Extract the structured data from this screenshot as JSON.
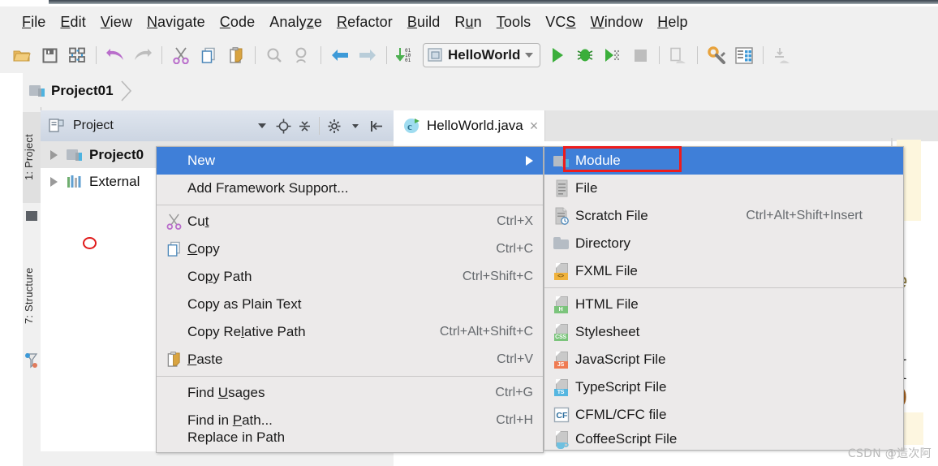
{
  "window": {
    "breadcrumb": "Project01"
  },
  "menubar": {
    "items": [
      {
        "label": "File",
        "mnemonic": "F"
      },
      {
        "label": "Edit",
        "mnemonic": "E"
      },
      {
        "label": "View",
        "mnemonic": "V"
      },
      {
        "label": "Navigate",
        "mnemonic": "N"
      },
      {
        "label": "Code",
        "mnemonic": "C"
      },
      {
        "label": "Analyze",
        "mnemonic": "z"
      },
      {
        "label": "Refactor",
        "mnemonic": "R"
      },
      {
        "label": "Build",
        "mnemonic": "B"
      },
      {
        "label": "Run",
        "mnemonic": "u"
      },
      {
        "label": "Tools",
        "mnemonic": "T"
      },
      {
        "label": "VCS",
        "mnemonic": "S"
      },
      {
        "label": "Window",
        "mnemonic": "W"
      },
      {
        "label": "Help",
        "mnemonic": "H"
      }
    ]
  },
  "toolbar": {
    "buttons": [
      {
        "icon": "open-folder-icon"
      },
      {
        "icon": "save-all-icon"
      },
      {
        "icon": "sync-icon"
      },
      {
        "icon": "separator"
      },
      {
        "icon": "undo-icon"
      },
      {
        "icon": "redo-icon"
      },
      {
        "icon": "separator"
      },
      {
        "icon": "cut-icon"
      },
      {
        "icon": "copy-icon"
      },
      {
        "icon": "paste-icon"
      },
      {
        "icon": "separator"
      },
      {
        "icon": "find-icon"
      },
      {
        "icon": "replace-icon"
      },
      {
        "icon": "separator"
      },
      {
        "icon": "back-icon"
      },
      {
        "icon": "forward-icon"
      },
      {
        "icon": "separator"
      },
      {
        "icon": "compile-icon"
      }
    ],
    "run_config": "HelloWorld",
    "right_buttons": [
      {
        "icon": "run-icon"
      },
      {
        "icon": "debug-icon"
      },
      {
        "icon": "run-coverage-icon"
      },
      {
        "icon": "stop-icon"
      },
      {
        "icon": "separator"
      },
      {
        "icon": "update-app-icon"
      },
      {
        "icon": "separator"
      },
      {
        "icon": "settings-icon"
      },
      {
        "icon": "project-structure-icon"
      },
      {
        "icon": "separator"
      },
      {
        "icon": "deploy-icon"
      }
    ]
  },
  "sidebar": {
    "tabs": [
      {
        "label": "1: Project",
        "selected": true
      },
      {
        "label": "7: Structure",
        "selected": false
      }
    ],
    "bottom_icon": "favorites-icon"
  },
  "tool_window": {
    "title": "Project",
    "actions": [
      {
        "icon": "chevron-down-icon"
      },
      {
        "icon": "locate-icon"
      },
      {
        "icon": "collapse-all-icon"
      },
      {
        "icon": "gear-icon"
      },
      {
        "icon": "hide-icon"
      }
    ],
    "tree": [
      {
        "label": "Project0",
        "bold": true,
        "icon": "module-icon",
        "selected": true
      },
      {
        "label": "External",
        "bold": false,
        "icon": "libraries-icon",
        "selected": false
      }
    ]
  },
  "editor": {
    "tabs": [
      {
        "label": "HelloWorld.java",
        "icon": "java-class-icon",
        "active": true,
        "close": "×"
      }
    ]
  },
  "context_menu": {
    "items": [
      {
        "label": "New",
        "icon": "",
        "accel": "",
        "submenu": true,
        "highlighted": true
      },
      {
        "label": "Add Framework Support...",
        "icon": "",
        "accel": "",
        "submenu": false,
        "highlighted": false
      },
      {
        "separator": true
      },
      {
        "label": "Cut",
        "mnemonic_tail": "t",
        "icon": "cut-icon",
        "accel": "Ctrl+X",
        "submenu": false,
        "highlighted": false
      },
      {
        "label": "Copy",
        "mnemonic_head": "C",
        "icon": "copy-icon",
        "accel": "Ctrl+C",
        "submenu": false,
        "highlighted": false
      },
      {
        "label": "Copy Path",
        "icon": "",
        "accel": "Ctrl+Shift+C",
        "submenu": false,
        "highlighted": false
      },
      {
        "label": "Copy as Plain Text",
        "icon": "",
        "accel": "",
        "submenu": false,
        "highlighted": false
      },
      {
        "label": "Copy Relative Path",
        "icon": "",
        "accel": "Ctrl+Alt+Shift+C",
        "submenu": false,
        "highlighted": false
      },
      {
        "label": "Paste",
        "mnemonic_head": "P",
        "icon": "paste-icon",
        "accel": "Ctrl+V",
        "submenu": false,
        "highlighted": false
      },
      {
        "separator": true
      },
      {
        "label": "Find Usages",
        "icon": "",
        "accel": "Ctrl+G",
        "submenu": false,
        "highlighted": false
      },
      {
        "label": "Find in Path...",
        "icon": "",
        "accel": "Ctrl+H",
        "submenu": false,
        "highlighted": false
      },
      {
        "label": "Replace in Path",
        "icon": "",
        "accel": "",
        "submenu": false,
        "highlighted": false,
        "clipped": true
      }
    ]
  },
  "new_submenu": {
    "items": [
      {
        "label": "Module",
        "icon": "module-icon",
        "accel": "",
        "highlighted": true,
        "outlined": true
      },
      {
        "label": "File",
        "icon": "file-icon",
        "accel": ""
      },
      {
        "label": "Scratch File",
        "icon": "scratch-file-icon",
        "accel": "Ctrl+Alt+Shift+Insert"
      },
      {
        "label": "Directory",
        "icon": "directory-icon",
        "accel": ""
      },
      {
        "label": "FXML File",
        "icon": "fxml-file-icon",
        "accel": "",
        "badge": "<>",
        "badge_color": "#f0b23c"
      },
      {
        "separator": true
      },
      {
        "label": "HTML File",
        "icon": "html-file-icon",
        "accel": "",
        "badge": "H",
        "badge_color": "#7cc47c"
      },
      {
        "label": "Stylesheet",
        "icon": "css-file-icon",
        "accel": "",
        "badge": "CSS",
        "badge_color": "#7cc47c"
      },
      {
        "label": "JavaScript File",
        "icon": "js-file-icon",
        "accel": "",
        "badge": "JS",
        "badge_color": "#ef7b52"
      },
      {
        "label": "TypeScript File",
        "icon": "ts-file-icon",
        "accel": "",
        "badge": "TS",
        "badge_color": "#56b6e0"
      },
      {
        "label": "CFML/CFC file",
        "icon": "cfml-file-icon",
        "accel": "",
        "badge": "CF",
        "badge_color": "#ffffff"
      },
      {
        "label": "CoffeeScript File",
        "icon": "coffeescript-file-icon",
        "accel": "",
        "clipped": true
      }
    ]
  },
  "colors": {
    "menu_highlight": "#3f7fd8",
    "red_outline": "#ee1c1c",
    "menu_bg": "#eceaea",
    "chrome_bg": "#f0f0f0"
  },
  "watermark": "CSDN @造次阿"
}
